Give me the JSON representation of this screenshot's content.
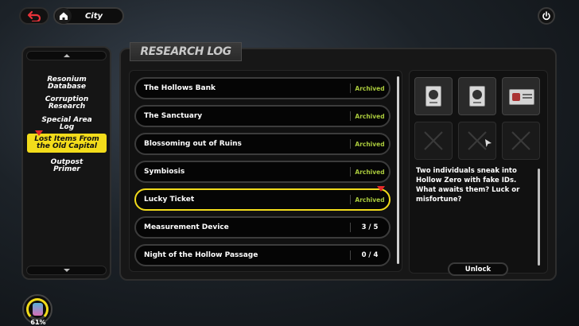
{
  "header": {
    "location": "City"
  },
  "panel": {
    "title": "RESEARCH LOG"
  },
  "categories": [
    {
      "label_line1": "Resonium",
      "label_line2": "Database"
    },
    {
      "label_line1": "Corruption",
      "label_line2": "Research"
    },
    {
      "label_line1": "Special Area",
      "label_line2": "Log"
    },
    {
      "label_line1": "Lost Items From",
      "label_line2": "the Old Capital"
    },
    {
      "label_line1": "Outpost",
      "label_line2": "Primer"
    }
  ],
  "entries": [
    {
      "name": "The Hollows Bank",
      "status": "Archived"
    },
    {
      "name": "The Sanctuary",
      "status": "Archived"
    },
    {
      "name": "Blossoming out of Ruins",
      "status": "Archived"
    },
    {
      "name": "Symbiosis",
      "status": "Archived"
    },
    {
      "name": "Lucky Ticket",
      "status": "Archived"
    },
    {
      "name": "Measurement Device",
      "status": "3 / 5"
    },
    {
      "name": "Night of the Hollow Passage",
      "status": "0 / 4"
    }
  ],
  "detail": {
    "description": "Two individuals sneak into Hollow Zero with fake IDs. What awaits them? Luck or misfortune?",
    "unlock_label": "Unlock"
  },
  "gauge": {
    "percent_label": "61%",
    "value": 0.61
  },
  "colors": {
    "accent_yellow": "#f2dc1b",
    "archived_green": "#a9c93c",
    "alert_red": "#e22a2a",
    "back_red": "#e8333a"
  },
  "icons": [
    "back-arrow-icon",
    "home-icon",
    "power-icon",
    "id-card-icon",
    "ticket-icon",
    "empty-slot-icon"
  ]
}
